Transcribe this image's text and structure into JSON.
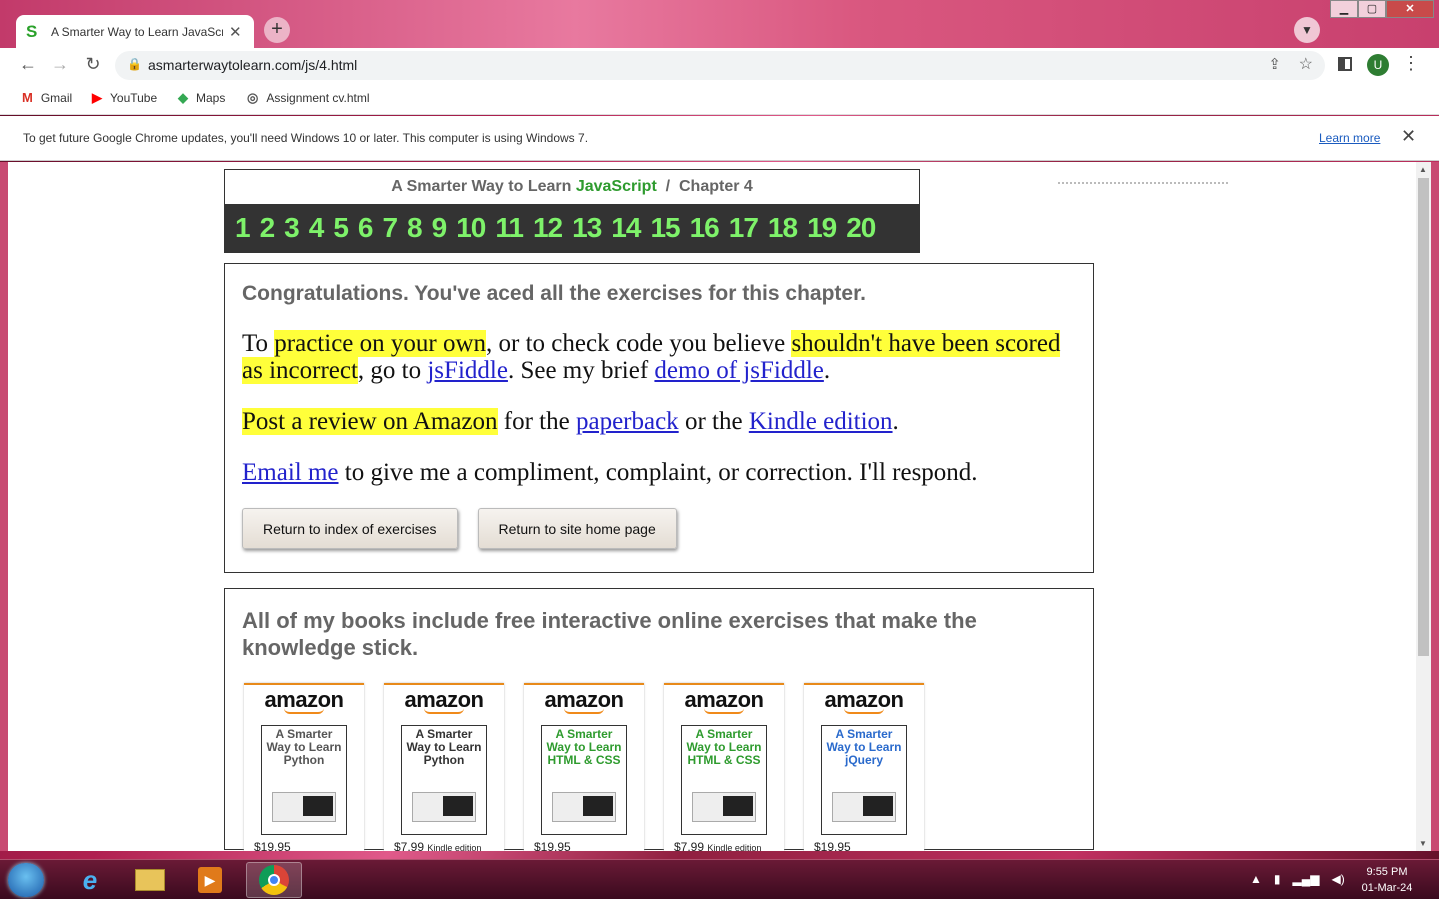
{
  "browser": {
    "tab_title": "A Smarter Way to Learn JavaScrip",
    "tab_close": "✕",
    "new_tab": "+",
    "url": "asmarterwaytolearn.com/js/4.html",
    "avatar_letter": "U",
    "bookmarks": [
      "Gmail",
      "YouTube",
      "Maps",
      "Assignment cv.html"
    ],
    "infobar_message": "To get future Google Chrome updates, you'll need Windows 10 or later. This computer is using Windows 7.",
    "infobar_link": "Learn more"
  },
  "page": {
    "header_prefix": "A Smarter Way to Learn ",
    "header_js": "JavaScript",
    "header_suffix": "  /  Chapter 4",
    "chapters": [
      "1",
      "2",
      "3",
      "4",
      "5",
      "6",
      "7",
      "8",
      "9",
      "10",
      "11",
      "12",
      "13",
      "14",
      "15",
      "16",
      "17",
      "18",
      "19",
      "20"
    ],
    "congrats": "Congratulations. You've aced all the exercises for this chapter.",
    "p1": {
      "t1": "To ",
      "h1": "practice on your own",
      "t2": ", or to check code you believe ",
      "h2": "shouldn't have been scored as incorrect",
      "t3": ", go to ",
      "l1": "jsFiddle",
      "t4": ". See my brief ",
      "l2": "demo of jsFiddle",
      "t5": "."
    },
    "p2": {
      "h1": "Post a review on Amazon",
      "t1": " for the ",
      "l1": "paperback",
      "t2": " or the ",
      "l2": "Kindle edition",
      "t3": "."
    },
    "p3": {
      "l1": "Email me",
      "t1": " to give me a compliment, complaint, or correction. I'll respond."
    },
    "btn_index": "Return to index of exercises",
    "btn_home": "Return to site home page",
    "books_heading": "All of my books include free interactive online exercises that make the knowledge stick.",
    "books": [
      {
        "brand": "amazon",
        "title": "A Smarter Way to Learn Python",
        "price": "$19.95",
        "edition": "",
        "color": "#555555"
      },
      {
        "brand": "amazon",
        "title": "A Smarter Way to Learn Python",
        "price": "$7.99",
        "edition": "Kindle edition",
        "color": "#333333"
      },
      {
        "brand": "amazon",
        "title": "A Smarter Way to Learn HTML & CSS",
        "price": "$19.95",
        "edition": "",
        "color": "#2e9b2e"
      },
      {
        "brand": "amazon",
        "title": "A Smarter Way to Learn HTML & CSS",
        "price": "$7.99",
        "edition": "Kindle edition",
        "color": "#2e9b2e"
      },
      {
        "brand": "amazon",
        "title": "A Smarter Way to Learn jQuery",
        "price": "$19.95",
        "edition": "",
        "color": "#2a6acc"
      }
    ]
  },
  "taskbar": {
    "time": "9:55 PM",
    "date": "01-Mar-24"
  }
}
